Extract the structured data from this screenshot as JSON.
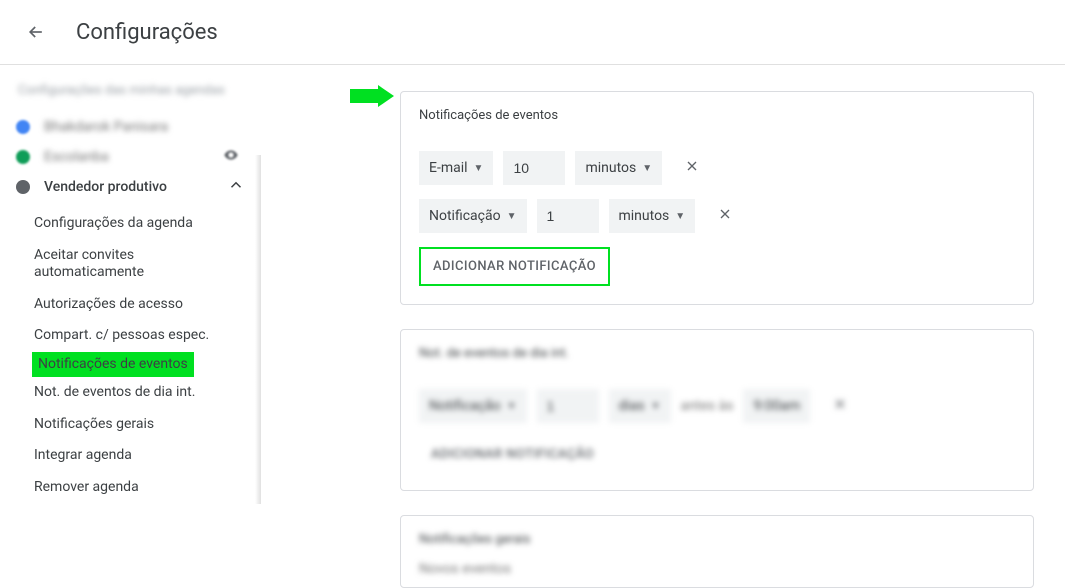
{
  "header": {
    "title": "Configurações"
  },
  "sidebar": {
    "section_header": "Configurações das minhas agendas",
    "calendars": [
      {
        "label": "Bhakdarok Panisara",
        "blurred": true,
        "color": "blue",
        "tail": ""
      },
      {
        "label": "Escolanba",
        "blurred": true,
        "color": "green",
        "tail": "eye"
      },
      {
        "label": "Vendedor produtivo",
        "blurred": false,
        "color": "grey",
        "expanded": true
      }
    ],
    "subitems": [
      "Configurações da agenda",
      "Aceitar convites automaticamente",
      "Autorizações de acesso",
      "Compart. c/ pessoas espec.",
      "Notificações de eventos",
      "Not. de eventos de dia int.",
      "Notificações gerais",
      "Integrar agenda",
      "Remover agenda"
    ],
    "highlight_index": 4
  },
  "main": {
    "card1": {
      "title": "Notificações de eventos",
      "rows": [
        {
          "type": "E-mail",
          "value": "10",
          "unit": "minutos"
        },
        {
          "type": "Notificação",
          "value": "1",
          "unit": "minutos"
        }
      ],
      "add_label": "ADICIONAR NOTIFICAÇÃO"
    },
    "card2": {
      "title": "Not. de eventos de dia int.",
      "rows": [
        {
          "type": "Notificação",
          "value": "1",
          "unit": "dias",
          "extra1": "antes às",
          "extra2": "9:00am"
        }
      ],
      "add_label": "ADICIONAR NOTIFICAÇÃO"
    },
    "card3": {
      "title": "Notificações gerais",
      "sub": "Novos eventos"
    }
  }
}
